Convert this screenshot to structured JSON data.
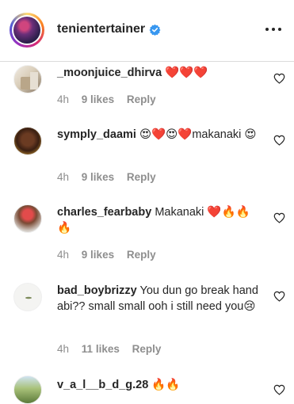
{
  "header": {
    "username": "tenientertainer",
    "avatar_icon": "profile-avatar",
    "verified_icon": "verified-badge-icon",
    "more_icon": "more-options-icon"
  },
  "comments": [
    {
      "username": "_moonjuice_dhirva",
      "text": "❤️❤️❤️",
      "time": "4h",
      "likes": "9 likes",
      "reply": "Reply"
    },
    {
      "username": "symply_daami",
      "text": "😍❤️😍❤️makanaki 😍",
      "time": "4h",
      "likes": "9 likes",
      "reply": "Reply"
    },
    {
      "username": "charles_fearbaby",
      "text": "Makanaki ❤️🔥🔥 🔥",
      "time": "4h",
      "likes": "9 likes",
      "reply": "Reply"
    },
    {
      "username": "bad_boybrizzy",
      "text": "You dun go break hand abi?? small small ooh i still need you😢",
      "time": "4h",
      "likes": "11 likes",
      "reply": "Reply"
    },
    {
      "username": "v_a_l__b_d_g.28",
      "text": "🔥🔥",
      "time": "",
      "likes": "",
      "reply": ""
    }
  ],
  "colors": {
    "text": "#262626",
    "meta": "#8e8e8e",
    "verified": "#3897f0",
    "divider": "#dbdbdb"
  }
}
